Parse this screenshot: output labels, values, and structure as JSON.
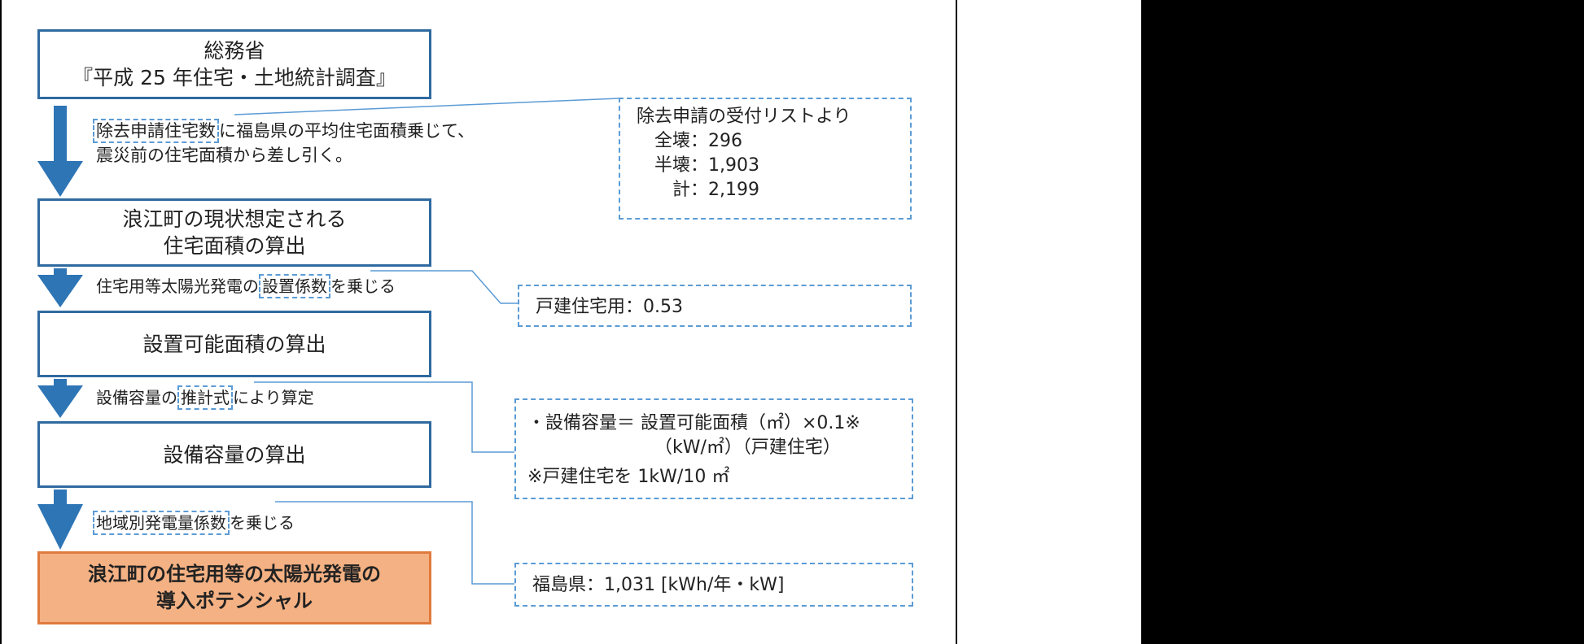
{
  "boxes": {
    "b1_line1": "総務省",
    "b1_line2": "『平成 25 年住宅・土地統計調査』",
    "b2_line1": "浪江町の現状想定される",
    "b2_line2": "住宅面積の算出",
    "b3": "設置可能面積の算出",
    "b4": "設備容量の算出",
    "b5_line1": "浪江町の住宅用等の太陽光発電の",
    "b5_line2": "導入ポテンシャル"
  },
  "steps": {
    "s1_hl": "除去申請住宅数",
    "s1_a": "に福島県の平均住宅面積乗じて、",
    "s1_line2": "震災前の住宅面積から差し引く。",
    "s2_pre": "住宅用等太陽光発電の",
    "s2_hl": "設置係数",
    "s2_post": "を乗じる",
    "s3_pre": "設備容量の",
    "s3_hl": "推計式",
    "s3_post": "により算定",
    "s4_hl": "地域別発電量係数",
    "s4_post": "を乗じる"
  },
  "notes": {
    "n1_line1": "除去申請の受付リストより",
    "n1_line2": "全壊：296",
    "n1_line3": "半壊：1,903",
    "n1_line4": "計：2,199",
    "n2": "戸建住宅用：0.53",
    "n3_line1": "・設備容量＝ 設置可能面積（㎡）×0.1※",
    "n3_line2": "（kW/㎡）（戸建住宅）",
    "n3_line3": "※戸建住宅を 1kW/10 ㎡",
    "n4": "福島県：1,031 [kWh/年・kW]"
  }
}
